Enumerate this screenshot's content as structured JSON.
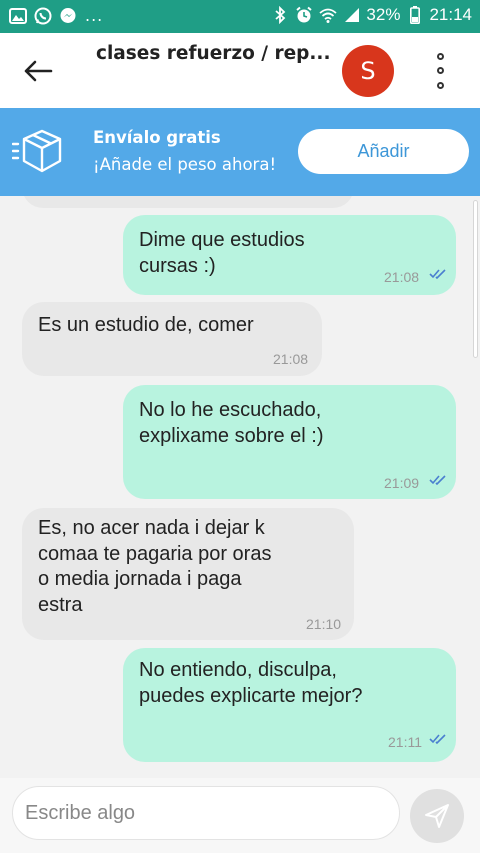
{
  "status_bar": {
    "left_icons": [
      "gallery-icon",
      "whatsapp-icon",
      "messenger-icon"
    ],
    "more": "...",
    "right_icons": [
      "bluetooth-icon",
      "alarm-icon",
      "wifi-icon",
      "signal-icon"
    ],
    "battery": "32%",
    "time": "21:14"
  },
  "header": {
    "title": "clases refuerzo / rep...",
    "avatar_letter": "S"
  },
  "promo": {
    "title": "Envíalo gratis",
    "subtitle": "¡Añade el peso ahora!",
    "button": "Añadir"
  },
  "messages": [
    {
      "side": "sent",
      "text": "Dime que estudios\ncursas :)",
      "time": "21:08",
      "read": true
    },
    {
      "side": "recv",
      "text": "Es un estudio de, comer",
      "time": "21:08"
    },
    {
      "side": "sent",
      "text": "No lo he escuchado,\nexplixame sobre el :)",
      "time": "21:09",
      "read": true
    },
    {
      "side": "recv",
      "text": "Es, no acer nada i dejar k\ncomaa te pagaria por oras\no media jornada i paga\nestra",
      "time": "21:10"
    },
    {
      "side": "sent",
      "text": "No entiendo, disculpa,\npuedes explicarte mejor?",
      "time": "21:11",
      "read": true
    }
  ],
  "composer": {
    "placeholder": "Escribe algo"
  },
  "colors": {
    "status_bar": "#1f9e86",
    "promo": "#53a9e8",
    "sent_bubble": "#b8f3df",
    "received_bubble": "#e8e8e8",
    "avatar": "#d8361c",
    "tick_blue": "#4a7fd0"
  }
}
